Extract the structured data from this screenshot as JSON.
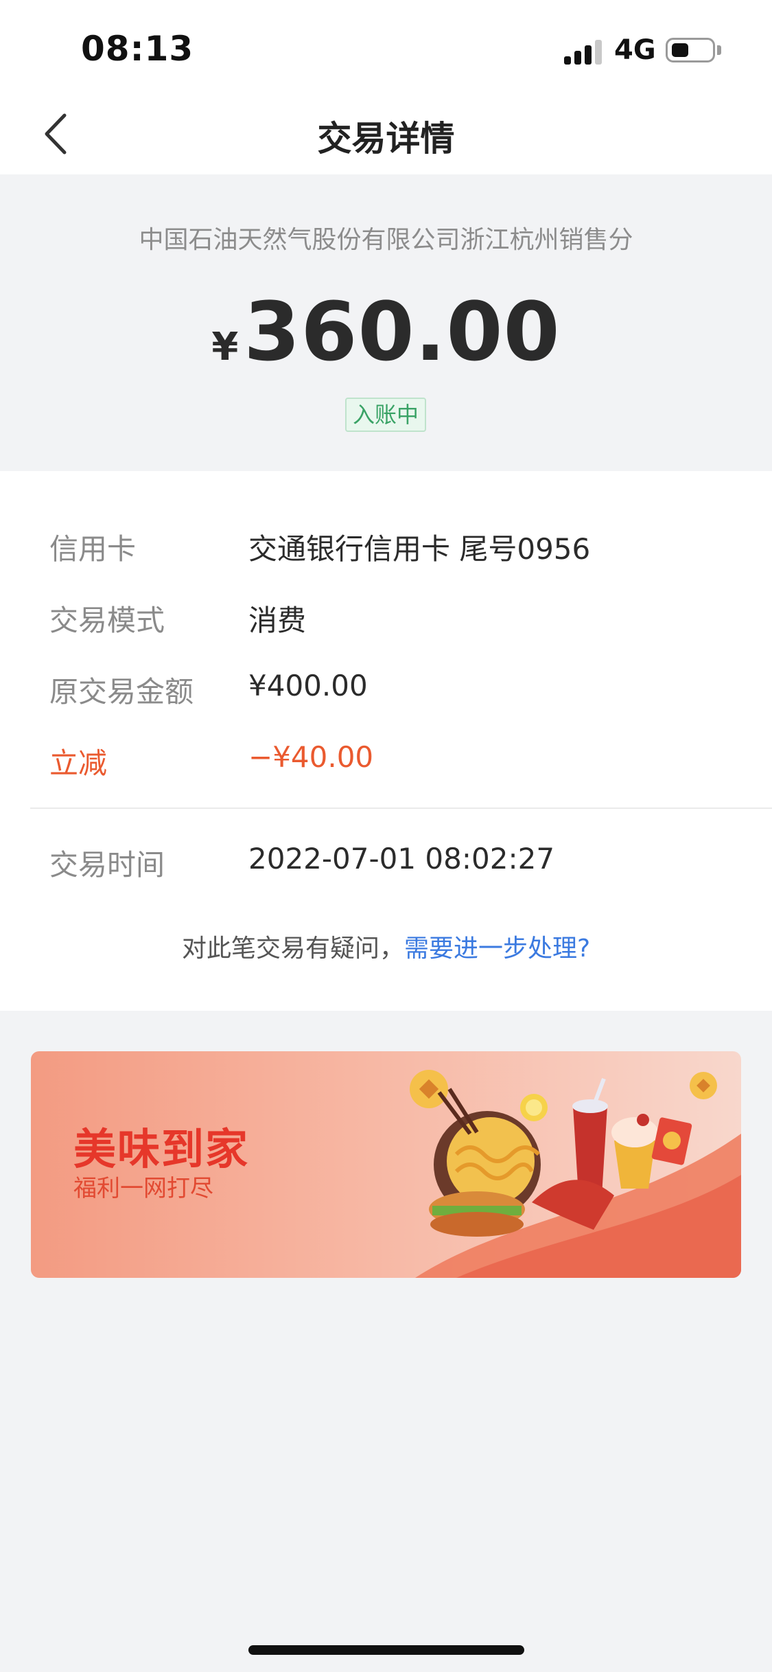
{
  "status_bar": {
    "time": "08:13",
    "network": "4G",
    "battery_level": 0.45
  },
  "nav": {
    "title": "交易详情",
    "back_icon": "chevron-left-icon"
  },
  "summary": {
    "merchant": "中国石油天然气股份有限公司浙江杭州销售分",
    "currency": "¥",
    "amount": "360.00",
    "status": "入账中"
  },
  "details": {
    "rows": [
      {
        "label": "信用卡",
        "value": "交通银行信用卡 尾号0956"
      },
      {
        "label": "交易模式",
        "value": "消费"
      },
      {
        "label": "原交易金额",
        "value": "¥400.00"
      },
      {
        "label": "立减",
        "value": "−¥40.00"
      }
    ],
    "time_row": {
      "label": "交易时间",
      "value": "2022-07-01 08:02:27"
    },
    "query_text": "对此笔交易有疑问，",
    "query_link": "需要进一步处理?"
  },
  "banner": {
    "title": "美味到家",
    "subtitle": "福利一网打尽"
  },
  "colors": {
    "accent_red": "#ea5a2f",
    "link_blue": "#3b7ae0",
    "badge_green": "#3aa366"
  }
}
